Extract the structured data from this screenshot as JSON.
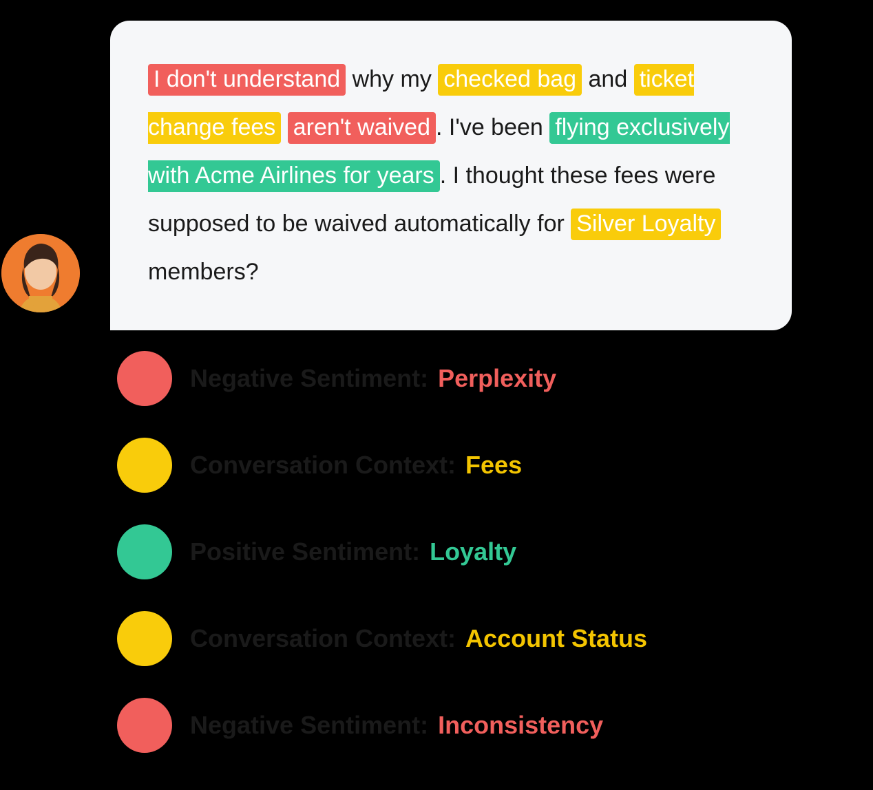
{
  "colors": {
    "red": "#f15f5c",
    "yellow": "#f9cc0b",
    "green": "#33c894",
    "avatar_bg": "#ef7c2f"
  },
  "message": {
    "segments": [
      {
        "text": "I don't understand",
        "hl": "red"
      },
      {
        "text": " why my "
      },
      {
        "text": "checked bag",
        "hl": "yellow"
      },
      {
        "text": " and "
      },
      {
        "text": "ticket change fees",
        "hl": "yellow"
      },
      {
        "text": " ",
        "nohl_space": true
      },
      {
        "text": "aren't waived",
        "hl": "red"
      },
      {
        "text": ". I've been "
      },
      {
        "text": "flying exclusively with Acme Airlines for years",
        "hl": "green"
      },
      {
        "text": ".  I thought these fees were supposed to be waived automatically for "
      },
      {
        "text": "Silver Loyalty",
        "hl": "yellow"
      },
      {
        "text": " members?"
      }
    ]
  },
  "legend": [
    {
      "dot": "red",
      "label": "Negative Sentiment:",
      "value": "Perplexity",
      "value_color": "red"
    },
    {
      "dot": "yellow",
      "label": "Conversation Context:",
      "value": "Fees",
      "value_color": "yellow"
    },
    {
      "dot": "green",
      "label": "Positive Sentiment:",
      "value": "Loyalty",
      "value_color": "green"
    },
    {
      "dot": "yellow",
      "label": "Conversation Context:",
      "value": "Account Status",
      "value_color": "yellow"
    },
    {
      "dot": "red",
      "label": "Negative Sentiment:",
      "value": "Inconsistency",
      "value_color": "red"
    }
  ]
}
